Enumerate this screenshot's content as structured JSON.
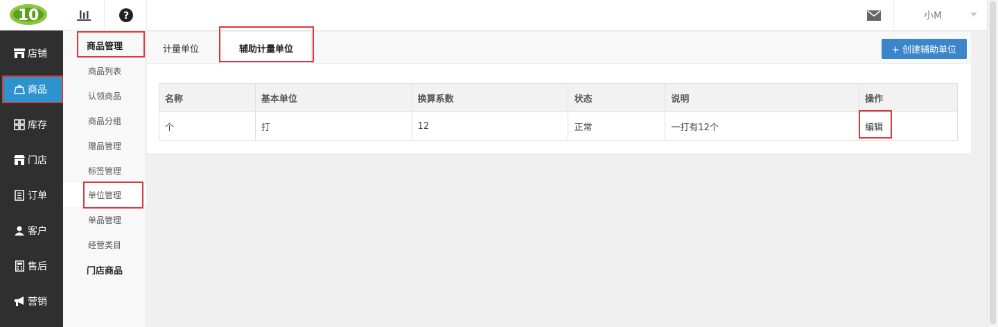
{
  "header": {
    "logo_text": "10",
    "user_name": "小M"
  },
  "left_nav": {
    "items": [
      {
        "label": "店铺",
        "icon": "store-icon"
      },
      {
        "label": "商品",
        "icon": "goods-icon"
      },
      {
        "label": "库存",
        "icon": "grid-icon"
      },
      {
        "label": "门店",
        "icon": "shop-icon"
      },
      {
        "label": "订单",
        "icon": "document-icon"
      },
      {
        "label": "客户",
        "icon": "user-icon"
      },
      {
        "label": "售后",
        "icon": "calculator-icon"
      },
      {
        "label": "营销",
        "icon": "megaphone-icon"
      }
    ],
    "active": "商品"
  },
  "sub_nav": {
    "group_title": "商品管理",
    "items": [
      "商品列表",
      "认领商品",
      "商品分组",
      "赠品管理",
      "标签管理",
      "单位管理",
      "单品管理",
      "经营类目"
    ],
    "current": "单位管理",
    "group_title_2": "门店商品"
  },
  "tabs": {
    "tab1": "计量单位",
    "tab2": "辅助计量单位",
    "create_button": "+ 创建辅助单位"
  },
  "table": {
    "headers": [
      "名称",
      "基本单位",
      "换算系数",
      "状态",
      "说明",
      "操作"
    ],
    "rows": [
      {
        "name": "个",
        "base_unit": "打",
        "factor": "12",
        "status": "正常",
        "desc": "一打有12个",
        "action": "编辑"
      }
    ]
  },
  "colors": {
    "nav_bg": "#2f2f2f",
    "active_blue": "#2c93cf",
    "button_blue": "#3b86c9",
    "highlight_red": "#d9393b"
  }
}
